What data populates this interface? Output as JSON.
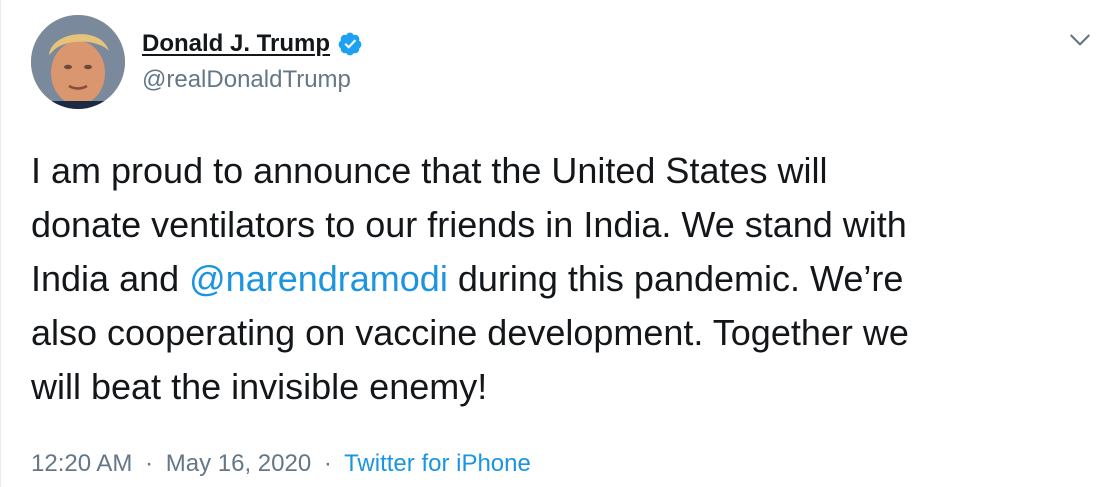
{
  "user": {
    "display_name": "Donald J. Trump",
    "handle": "@realDonaldTrump",
    "verified": true,
    "verified_icon": "verified-badge-icon",
    "avatar_icon": "avatar"
  },
  "tweet": {
    "text_part1": "I am proud to announce that the United States will\ndonate ventilators to our friends in India. We stand with\nIndia and ",
    "mention": "@narendramodi",
    "text_part2": " during this pandemic. We’re\nalso cooperating on vaccine development. Together we\nwill beat the invisible enemy!"
  },
  "meta": {
    "time": "12:20 AM",
    "date": "May 16, 2020",
    "separator": "·",
    "source": "Twitter for iPhone"
  },
  "colors": {
    "link": "#1b95e0",
    "secondary_text": "#657786",
    "primary_text": "#14171a",
    "verified": "#1da1f2"
  },
  "menu": {
    "caret_icon": "chevron-down-icon"
  }
}
